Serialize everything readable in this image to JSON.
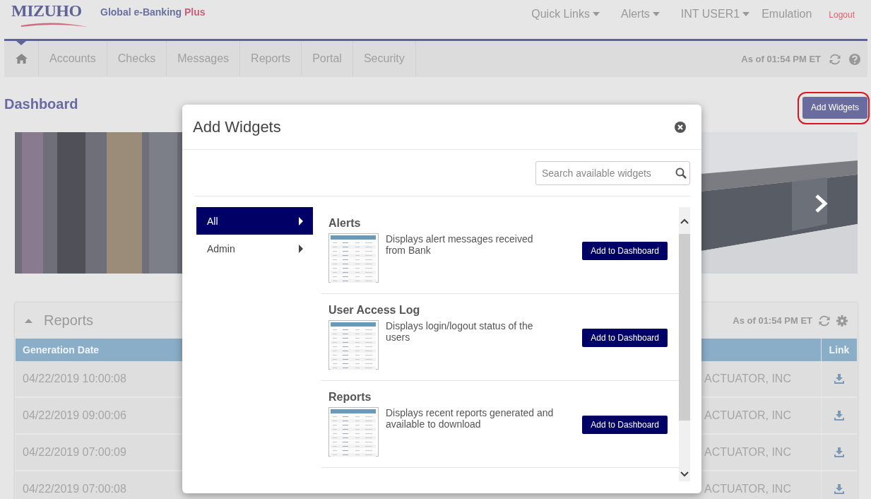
{
  "header": {
    "logo": "MIZUHO",
    "product": "Global e-Banking",
    "product_suffix": "Plus",
    "links": [
      {
        "label": "Quick Links",
        "dropdown": true
      },
      {
        "label": "Alerts",
        "dropdown": true
      },
      {
        "label": "INT USER1",
        "dropdown": true
      },
      {
        "label": "Emulation",
        "dropdown": false
      }
    ],
    "logout": "Logout"
  },
  "nav": {
    "tabs": [
      {
        "kind": "home",
        "selected": true
      },
      {
        "kind": "text",
        "label": "Accounts",
        "selected": false
      },
      {
        "kind": "text",
        "label": "Checks",
        "selected": false
      },
      {
        "kind": "text",
        "label": "Messages",
        "selected": false
      },
      {
        "kind": "text",
        "label": "Reports",
        "selected": false
      },
      {
        "kind": "text",
        "label": "Portal",
        "selected": false
      },
      {
        "kind": "text",
        "label": "Security",
        "selected": false
      }
    ],
    "as_of": "As of 01:54 PM ET"
  },
  "dashboard": {
    "title": "Dashboard",
    "add_button": "Add Widgets",
    "add_button_highlighted": true,
    "reports_widget": {
      "title": "Reports",
      "expanded": true,
      "as_of": "As of 01:54 PM ET",
      "columns": [
        "Generation Date",
        "Link"
      ],
      "rows": [
        {
          "date": "04/22/2019 10:00:08",
          "column_3": "ACTUATOR, INC"
        },
        {
          "date": "04/22/2019 09:00:06",
          "column_3": "ACTUATOR, INC"
        },
        {
          "date": "04/22/2019 07:00:09",
          "column_3": "ACTUATOR, INC"
        },
        {
          "date": "04/22/2019 07:00:08",
          "column_3": "ACTUATOR, INC"
        }
      ]
    }
  },
  "modal": {
    "title": "Add Widgets",
    "search": {
      "placeholder": "Search available widgets"
    },
    "categories": [
      {
        "label": "All",
        "selected": true
      },
      {
        "label": "Admin",
        "selected": false
      }
    ],
    "widgets": [
      {
        "title": "Alerts",
        "description": "Displays alert messages received from Bank",
        "button": "Add to Dashboard"
      },
      {
        "title": "User Access Log",
        "description": "Displays login/logout status of the users",
        "button": "Add to Dashboard"
      },
      {
        "title": "Reports",
        "description": "Displays recent reports generated and available to download",
        "button": "Add to Dashboard"
      }
    ]
  }
}
